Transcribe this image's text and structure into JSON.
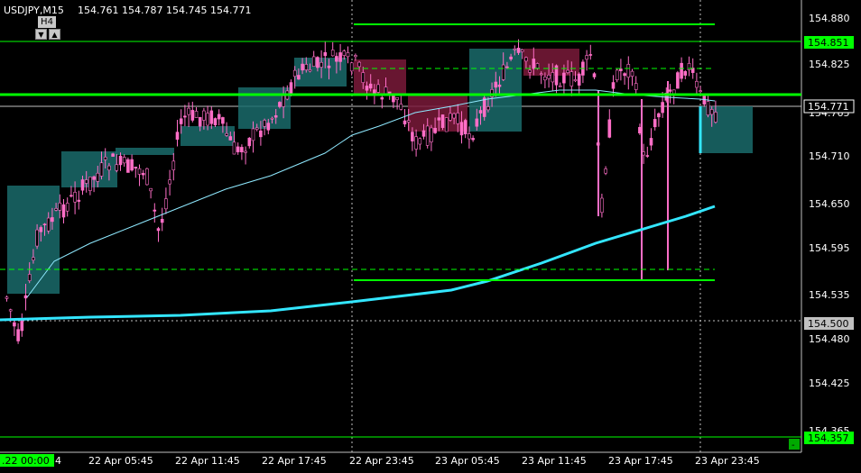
{
  "header": {
    "symbol": "USDJPY,M15",
    "ohlc": "154.761 154.787 154.745 154.771"
  },
  "timeframe_panel": {
    "label": "H4",
    "down_arrow": "▼",
    "up_arrow": "▲"
  },
  "price_scale": {
    "ticks": [
      "154.880",
      "154.825",
      "154.765",
      "154.710",
      "154.650",
      "154.595",
      "154.535",
      "154.480",
      "154.425",
      "154.365"
    ],
    "labels": [
      {
        "text": "154.851",
        "kind": "level"
      },
      {
        "text": "154.771",
        "kind": "current"
      },
      {
        "text": "154.500",
        "kind": "hline"
      },
      {
        "text": "154.357",
        "kind": "level"
      }
    ]
  },
  "time_axis": {
    "first_label": ".22 00:00",
    "first_suffix": "4",
    "ticks": [
      "22 Apr 05:45",
      "22 Apr 11:45",
      "22 Apr 17:45",
      "22 Apr 23:45",
      "23 Apr 05:45",
      "23 Apr 11:45",
      "23 Apr 17:45",
      "23 Apr 23:45"
    ]
  },
  "corner_button": "-",
  "colors": {
    "background": "#000000",
    "bull_candle": "#ff6ec7",
    "bear_candle": "#ff6ec7",
    "candle_wick": "#ff6ec7",
    "level_line": "#00ff00",
    "ma_slow": "#33e6ff",
    "ma_fast": "#8fe9ff",
    "demand_zone": "#1a6b6b",
    "supply_zone": "#7a1a3a"
  }
}
